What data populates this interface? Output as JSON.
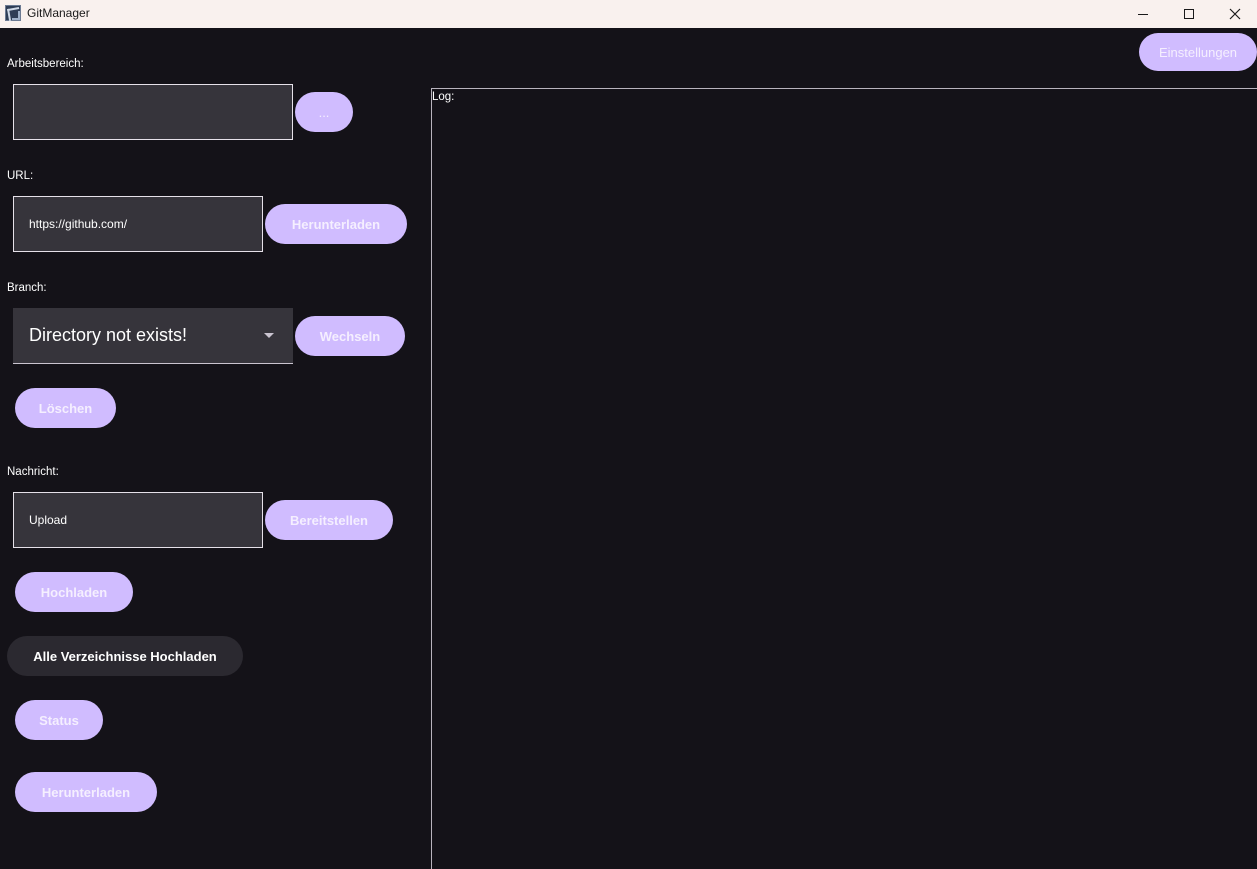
{
  "window": {
    "title": "GitManager",
    "controls": [
      "minimize",
      "maximize",
      "close"
    ]
  },
  "settings_button": "Einstellungen",
  "workspace": {
    "label": "Arbeitsbereich:",
    "value": "",
    "browse_button": "..."
  },
  "url": {
    "label": "URL:",
    "value": "https://github.com/",
    "download_button": "Herunterladen"
  },
  "branch": {
    "label": "Branch:",
    "selected": "Directory not exists!",
    "switch_button": "Wechseln",
    "delete_button": "Löschen"
  },
  "message": {
    "label": "Nachricht:",
    "value": "Upload",
    "commit_button": "Bereitstellen"
  },
  "actions": {
    "upload_button": "Hochladen",
    "upload_all_button": "Alle Verzeichnisse Hochladen",
    "status_button": "Status",
    "pull_button": "Herunterladen"
  },
  "log": {
    "label": "Log:",
    "content": ""
  },
  "colors": {
    "background": "#141218",
    "accent": "#d0bcff",
    "field_bg": "#36343b",
    "titlebar": "#f9f1ee"
  }
}
